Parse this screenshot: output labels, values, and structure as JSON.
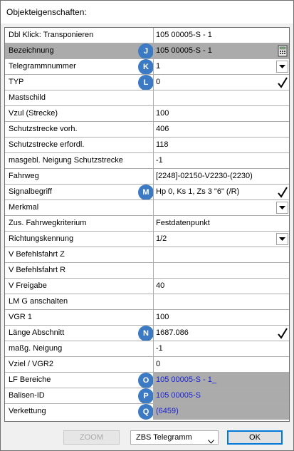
{
  "window": {
    "title": "Objekteigenschaften:"
  },
  "rows": [
    {
      "label": "Dbl Klick: Transponieren",
      "value": "105 00005-S - 1"
    },
    {
      "label": "Bezeichnung",
      "value": "105 00005-S - 1",
      "badge": "J",
      "control": "calculator-icon"
    },
    {
      "label": "Telegrammnummer",
      "value": "1",
      "badge": "K",
      "control": "dropdown"
    },
    {
      "label": "TYP",
      "value": "0",
      "badge": "L",
      "control": "checkmark-icon"
    },
    {
      "label": "Mastschild",
      "value": ""
    },
    {
      "label": "Vzul (Strecke)",
      "value": "100"
    },
    {
      "label": "Schutzstrecke vorh.",
      "value": "406"
    },
    {
      "label": "Schutzstrecke erfordl.",
      "value": "118"
    },
    {
      "label": "masgebl. Neigung Schutzstrecke",
      "value": "-1"
    },
    {
      "label": "Fahrweg",
      "value": "[2248]-02150-V2230-(2230)"
    },
    {
      "label": "Signalbegriff",
      "value": "Hp 0, Ks 1, Zs 3 \"6\" (/R)",
      "badge": "M",
      "control": "checkmark-icon"
    },
    {
      "label": "Merkmal",
      "value": "",
      "control": "dropdown"
    },
    {
      "label": "Zus. Fahrwegkriterium",
      "value": "Festdatenpunkt"
    },
    {
      "label": "Richtungskennung",
      "value": "1/2",
      "control": "dropdown"
    },
    {
      "label": "V Befehlsfahrt Z",
      "value": ""
    },
    {
      "label": "V Befehlsfahrt R",
      "value": ""
    },
    {
      "label": "V Freigabe",
      "value": "40"
    },
    {
      "label": "LM G anschalten",
      "value": ""
    },
    {
      "label": "VGR 1",
      "value": "100"
    },
    {
      "label": "Länge Abschnitt",
      "value": "1687.086",
      "badge": "N",
      "control": "checkmark-icon"
    },
    {
      "label": "maßg. Neigung",
      "value": "-1"
    },
    {
      "label": "Vziel / VGR2",
      "value": "0"
    },
    {
      "label": "LF Bereiche",
      "value": "105 00005-S - 1_",
      "badge": "O"
    },
    {
      "label": "Balisen-ID",
      "value": "105 00005-S",
      "badge": "P"
    },
    {
      "label": "Verkettung",
      "value": "(6459)",
      "badge": "Q"
    }
  ],
  "footer": {
    "zoom_label": "ZOOM",
    "select_value": "ZBS Telegramm",
    "ok_label": "OK"
  },
  "colors": {
    "badge": "#3c7bc4",
    "link_blue": "#1a24d6",
    "grey_cell": "#ababab"
  }
}
